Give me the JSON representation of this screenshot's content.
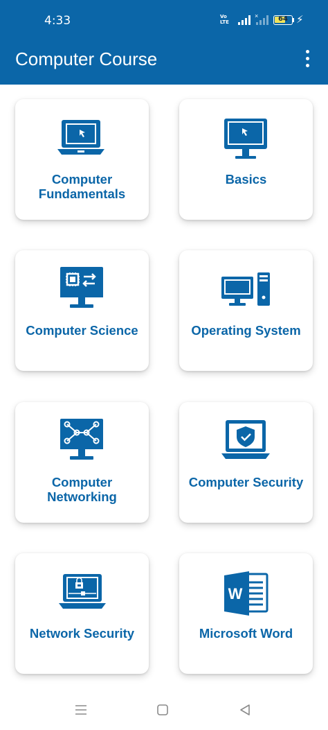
{
  "status_bar": {
    "time": "4:33",
    "network_label": "Vo\nLTE",
    "battery_level": "64",
    "battery_fraction": 0.64,
    "icons": [
      "volte-icon",
      "signal-icon",
      "signal-icon",
      "battery-icon",
      "charging-icon"
    ]
  },
  "app_bar": {
    "title": "Computer Course",
    "menu_icon": "more-vert-icon",
    "color": "#0b66a8"
  },
  "courses": [
    {
      "label": "Computer Fundamentals",
      "icon": "laptop-icon"
    },
    {
      "label": "Basics",
      "icon": "monitor-icon"
    },
    {
      "label": "Computer Science",
      "icon": "cpu-monitor-icon"
    },
    {
      "label": "Operating System",
      "icon": "desktop-pc-icon"
    },
    {
      "label": "Computer Networking",
      "icon": "network-monitor-icon"
    },
    {
      "label": "Computer Security",
      "icon": "shield-laptop-icon"
    },
    {
      "label": "Network Security",
      "icon": "lock-laptop-icon"
    },
    {
      "label": "Microsoft Word",
      "icon": "word-icon"
    }
  ],
  "nav_bar": {
    "items": [
      "menu-icon",
      "home-icon",
      "back-icon"
    ]
  },
  "colors": {
    "primary": "#0b66a8",
    "battery": "#f1e35a"
  }
}
